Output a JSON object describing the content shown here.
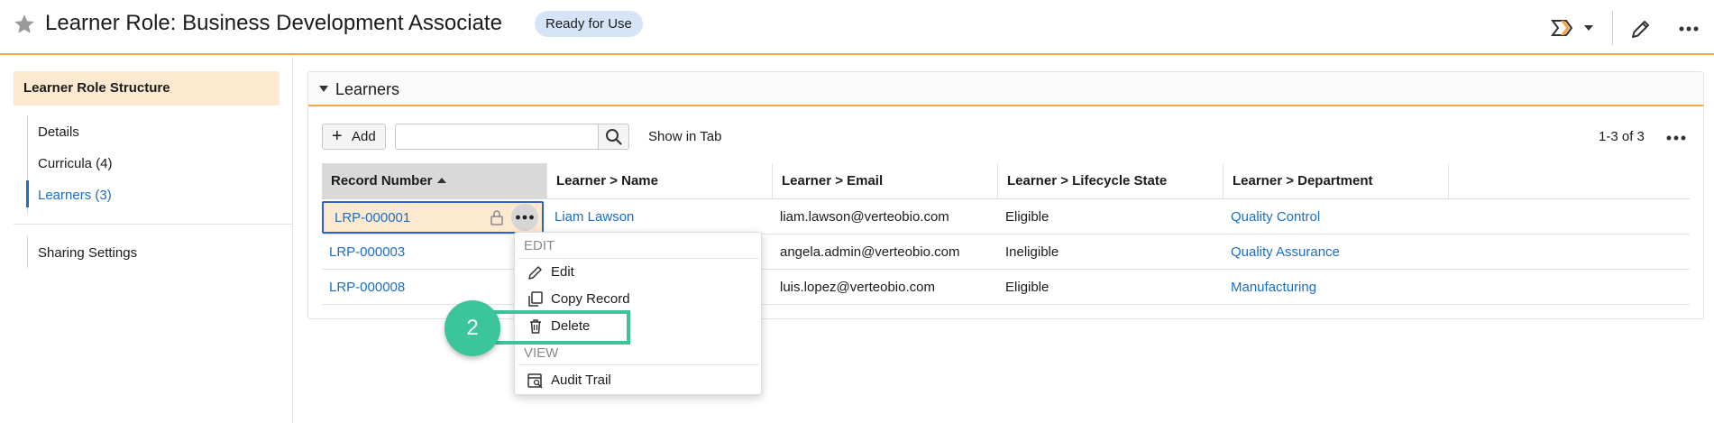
{
  "header": {
    "title": "Learner Role: Business Development Associate",
    "status_badge": "Ready for Use",
    "icons": [
      "star-icon",
      "workflow-icon",
      "chevron-down-icon",
      "pencil-icon",
      "more-icon"
    ]
  },
  "sidebar": {
    "heading": "Learner Role Structure",
    "items": [
      {
        "label": "Details",
        "active": false
      },
      {
        "label": "Curricula (4)",
        "active": false
      },
      {
        "label": "Learners (3)",
        "active": true
      }
    ],
    "footer_item": "Sharing Settings"
  },
  "panel": {
    "title": "Learners",
    "toolbar": {
      "add_label": "Add",
      "search_placeholder": "",
      "show_in_tab": "Show in Tab",
      "paging": "1-3 of 3"
    },
    "columns": [
      "Record Number",
      "Learner > Name",
      "Learner > Email",
      "Learner > Lifecycle State",
      "Learner > Department"
    ],
    "rows": [
      {
        "record": "LRP-000001",
        "name": "Liam Lawson",
        "email": "liam.lawson@verteobio.com",
        "state": "Eligible",
        "department": "Quality Control"
      },
      {
        "record": "LRP-000003",
        "name": "",
        "email": "angela.admin@verteobio.com",
        "state": "Ineligible",
        "department": "Quality Assurance"
      },
      {
        "record": "LRP-000008",
        "name": "",
        "email": "luis.lopez@verteobio.com",
        "state": "Eligible",
        "department": "Manufacturing"
      }
    ]
  },
  "context_menu": {
    "edit_section": "EDIT",
    "edit": "Edit",
    "copy": "Copy Record",
    "delete": "Delete",
    "view_section": "VIEW",
    "audit": "Audit Trail"
  },
  "annotation": {
    "step": "2",
    "color": "#3cc49a"
  },
  "colors": {
    "accent": "#f0a64a",
    "link": "#1a6fc4",
    "badge_bg": "#d6e4f8",
    "nav_highlight": "#fde9cf"
  }
}
